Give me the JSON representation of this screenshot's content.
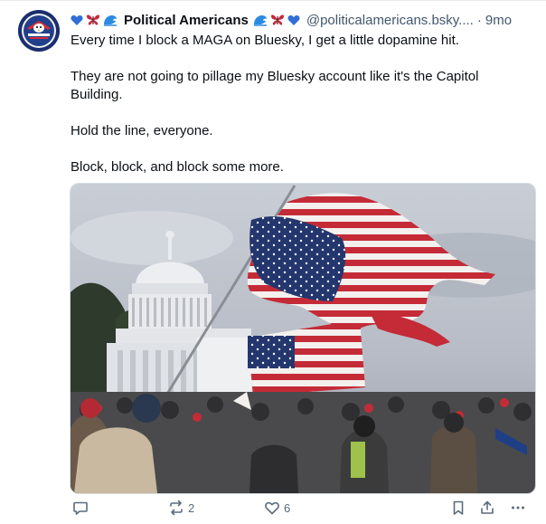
{
  "post": {
    "author_name": "Political Americans",
    "handle": "@politicalamericans.bsky....",
    "separator": "·",
    "time": "9mo",
    "paragraphs": [
      "Every time I block a MAGA on Bluesky, I get a little dopamine hit.",
      "They are not going to pillage my Bluesky account like it's the Capitol Building.",
      "Hold the line, everyone.",
      "Block, block, and block some more."
    ],
    "image_subject": "photo-capitol-torn-american-flags-crowd"
  },
  "actions": {
    "reposts": "2",
    "likes": "6"
  },
  "icons": {
    "prefix": [
      "blue-heart-icon",
      "butterfly-icon",
      "wave-icon"
    ],
    "suffix": [
      "wave-icon",
      "butterfly-icon",
      "blue-heart-icon"
    ],
    "actions": [
      "reply-icon",
      "repost-icon",
      "like-icon",
      "bookmark-icon",
      "share-icon",
      "more-icon"
    ]
  },
  "colors": {
    "heart": "#2f6fd6",
    "butterfly": "#c8283c",
    "wave": "#2a8be0",
    "muted": "#42576c"
  }
}
